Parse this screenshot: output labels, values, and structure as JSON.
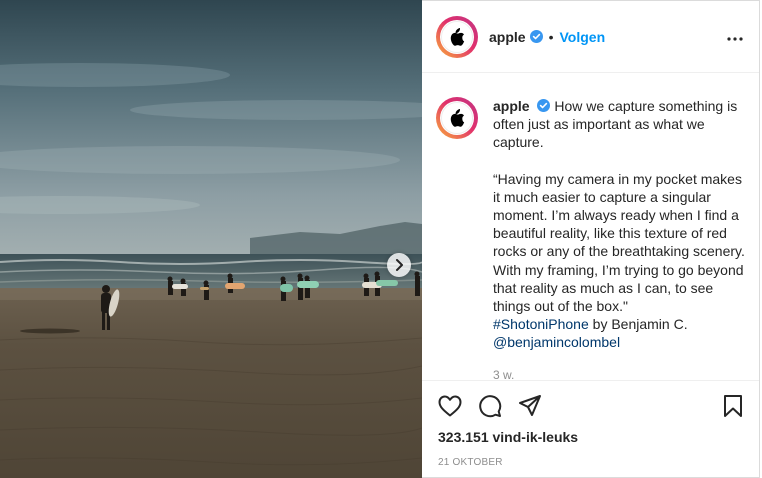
{
  "post": {
    "username": "apple",
    "follow_label": "Volgen",
    "separator": "•",
    "caption": {
      "intro": "How we capture something is often just as important as what we capture.",
      "quote": "“Having my camera in my pocket makes it much easier to capture a singular moment. I’m always ready when I find a beautiful reality, like this texture of red rocks or any of the breathtaking scenery. With my framing, I’m trying to go beyond that reality as much as I can, to see things out of the box.\"",
      "hashtag": "#ShotoniPhone",
      "byline": " by Benjamin C.",
      "mention": "@benjamincolombel"
    },
    "time_ago": "3 w.",
    "likes": "323.151 vind-ik-leuks",
    "date": "21 OKTOBER"
  },
  "colors": {
    "accent": "#0095f6",
    "verified": "#3897f0",
    "link": "#00376b",
    "muted": "#8e8e8e"
  },
  "icons": [
    "apple-logo-icon",
    "verified-icon",
    "more-icon",
    "heart-icon",
    "comment-icon",
    "share-icon",
    "bookmark-icon",
    "chevron-right-icon"
  ]
}
